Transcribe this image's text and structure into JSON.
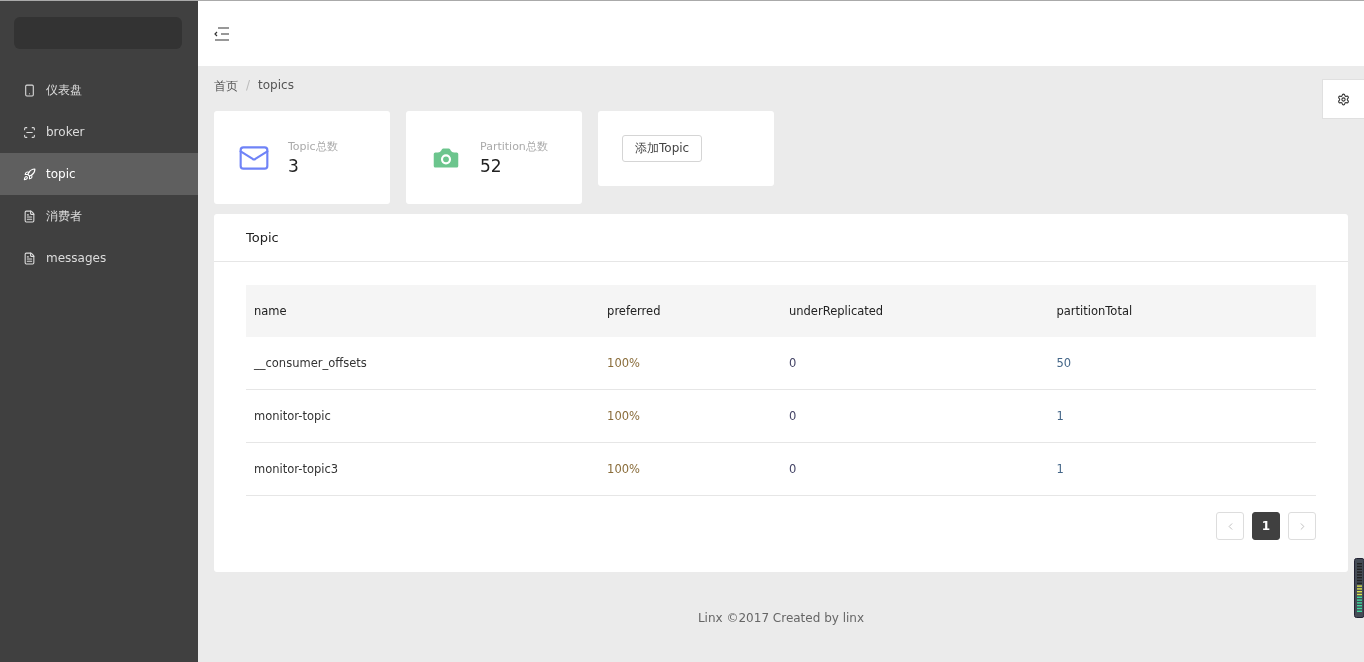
{
  "sidebar": {
    "items": [
      {
        "label": "仪表盘",
        "selected": false
      },
      {
        "label": "broker",
        "selected": false
      },
      {
        "label": "topic",
        "selected": true
      },
      {
        "label": "消费者",
        "selected": false
      },
      {
        "label": "messages",
        "selected": false
      }
    ]
  },
  "breadcrumb": {
    "items": [
      "首页",
      "topics"
    ],
    "separator": "/"
  },
  "stats": [
    {
      "label": "Topic总数",
      "value": "3"
    },
    {
      "label": "Partition总数",
      "value": "52"
    }
  ],
  "add_button": "添加Topic",
  "table_card": {
    "title": "Topic",
    "columns": [
      "name",
      "preferred",
      "underReplicated",
      "partitionTotal"
    ],
    "rows": [
      [
        "__consumer_offsets",
        "100%",
        "0",
        "50"
      ],
      [
        "monitor-topic",
        "100%",
        "0",
        "1"
      ],
      [
        "monitor-topic3",
        "100%",
        "0",
        "1"
      ]
    ],
    "pages": [
      {
        "label": "1",
        "selected": true
      }
    ]
  },
  "footer": "Linx ©2017 Created by linx"
}
